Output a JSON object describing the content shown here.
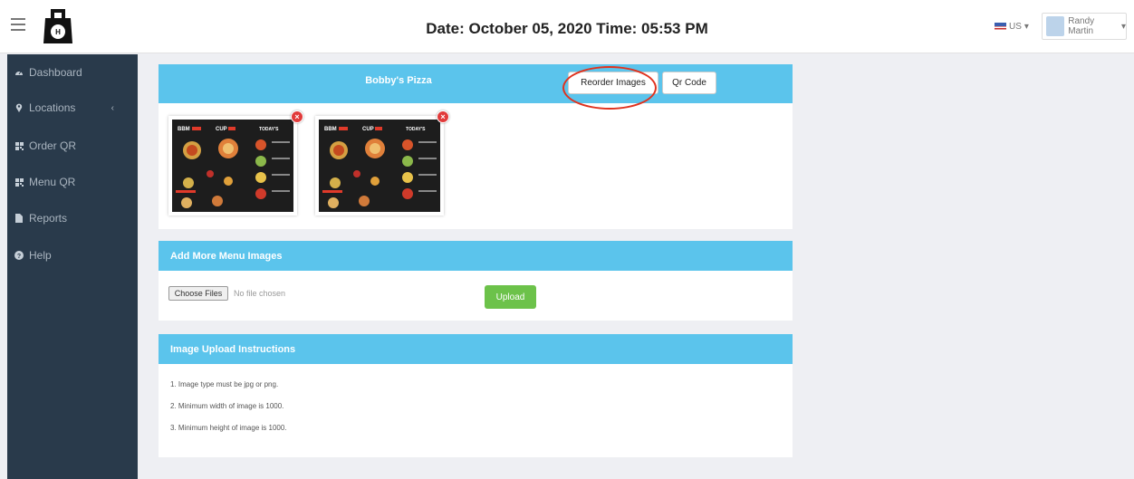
{
  "header": {
    "datetime": "Date: October 05, 2020  Time: 05:53 PM",
    "lang": "US",
    "user_name": "Randy Martin"
  },
  "sidebar": {
    "items": [
      {
        "label": "Dashboard",
        "icon": "dashboard-icon"
      },
      {
        "label": "Locations",
        "icon": "location-pin-icon",
        "caret": "‹"
      },
      {
        "label": "Order QR",
        "icon": "qr-icon"
      },
      {
        "label": "Menu QR",
        "icon": "qr-icon"
      },
      {
        "label": "Reports",
        "icon": "file-icon"
      },
      {
        "label": "Help",
        "icon": "help-icon"
      }
    ]
  },
  "menu_panel": {
    "title": "Bobby's Pizza",
    "reorder_label": "Reorder Images",
    "qr_label": "Qr Code",
    "delete_symbol": "×",
    "images": [
      {
        "headings": [
          "BBM",
          "CUP",
          "TODAY'S"
        ]
      },
      {
        "headings": [
          "BBM",
          "CUP",
          "TODAY'S"
        ]
      }
    ]
  },
  "upload_panel": {
    "title": "Add More Menu Images",
    "choose_label": "Choose Files",
    "no_file": "No file chosen",
    "upload_label": "Upload"
  },
  "instructions_panel": {
    "title": "Image Upload Instructions",
    "items": [
      "1. Image type must be jpg or png.",
      "2. Minimum width of image is 1000.",
      "3. Minimum height of image is 1000."
    ]
  },
  "colors": {
    "sidebar_bg": "#293a4b",
    "panel_header": "#5bc4ec",
    "upload_button": "#6cc24a",
    "delete_badge": "#e13b3b",
    "highlight_circle": "#e0321e"
  }
}
